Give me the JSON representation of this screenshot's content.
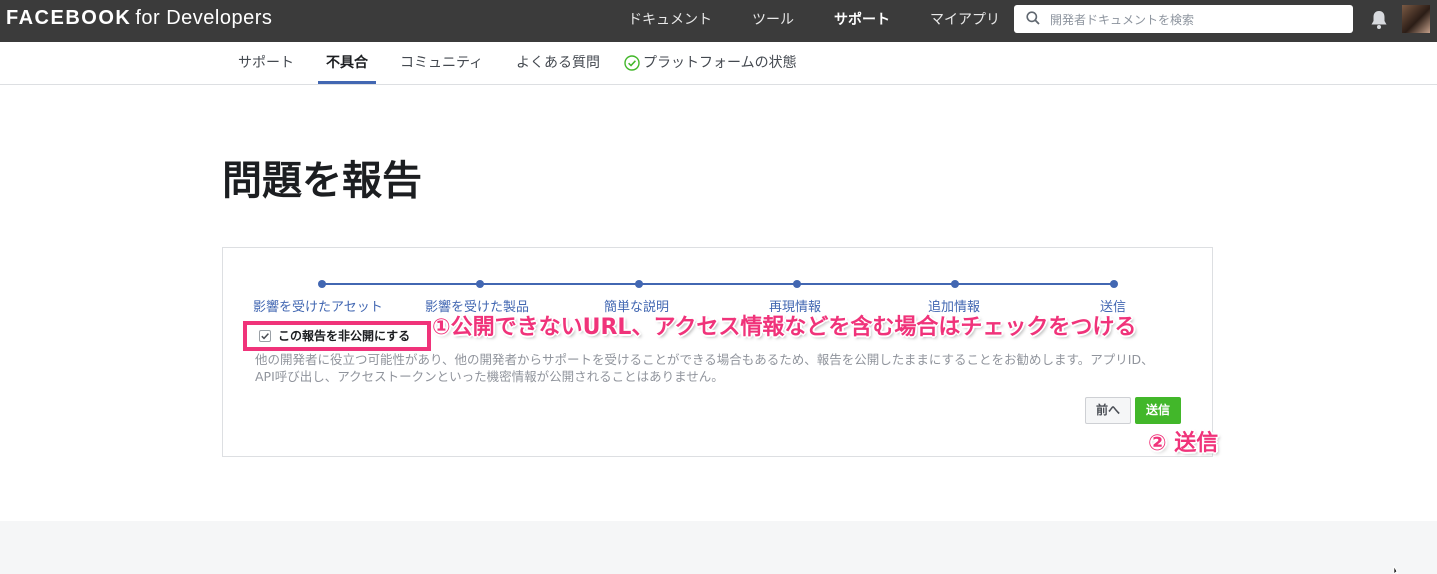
{
  "header": {
    "brand_main": "FACEBOOK",
    "brand_sub": "for Developers",
    "nav": [
      {
        "label": "ドキュメント",
        "active": false
      },
      {
        "label": "ツール",
        "active": false
      },
      {
        "label": "サポート",
        "active": true
      },
      {
        "label": "マイアプリ",
        "active": false
      }
    ],
    "search_placeholder": "開発者ドキュメントを検索"
  },
  "subnav": {
    "items": [
      {
        "label": "サポート",
        "active": false
      },
      {
        "label": "不具合",
        "active": true
      },
      {
        "label": "コミュニティ",
        "active": false
      },
      {
        "label": "よくある質問",
        "active": false
      },
      {
        "label": "プラットフォームの状態",
        "active": false
      }
    ]
  },
  "page": {
    "title": "問題を報告"
  },
  "form": {
    "steps": [
      "影響を受けたアセット",
      "影響を受けた製品",
      "簡単な説明",
      "再現情報",
      "追加情報",
      "送信"
    ],
    "private_checkbox_label": "この報告を非公開にする",
    "private_checked": true,
    "help_text": "他の開発者に役立つ可能性があり、他の開発者からサポートを受けることができる場合もあるため、報告を公開したままにすることをお勧めします。アプリID、API呼び出し、アクセストークンといった機密情報が公開されることはありません。",
    "prev_label": "前へ",
    "submit_label": "送信"
  },
  "annotations": {
    "note1": "①公開できないURL、アクセス情報などを含む場合はチェックをつける",
    "note2": "② 送信"
  },
  "colors": {
    "topbar": "#3b3b3b",
    "accent_blue": "#4267b2",
    "submit_green": "#42b72a",
    "annotation_pink": "#f0337a"
  }
}
